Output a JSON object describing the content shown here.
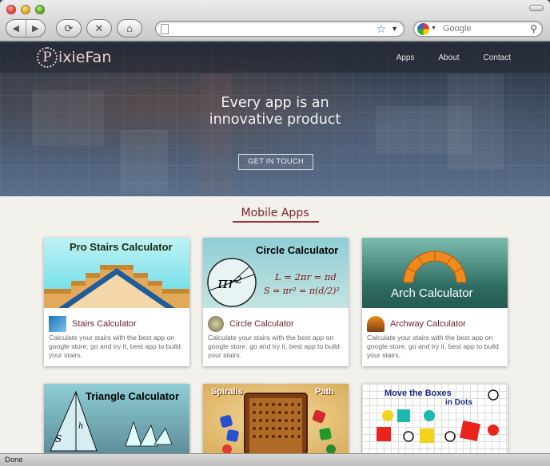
{
  "browser": {
    "url": "",
    "search_placeholder": "Google",
    "status_text": "Done"
  },
  "site": {
    "logo_initial": "P",
    "logo_rest": "ixieFan",
    "nav": [
      {
        "label": "Apps"
      },
      {
        "label": "About"
      },
      {
        "label": "Contact"
      }
    ],
    "hero": {
      "headline_line1": "Every app is an",
      "headline_line2": "innovative product",
      "cta_label": "GET IN TOUCH"
    },
    "section_title": "Mobile Apps",
    "apps": [
      {
        "image_title": "Pro Stairs Calculator",
        "name": "Stairs Calculator",
        "description": "Calculate your stairs with the best app on google store. go and try it, best app to build your stairs."
      },
      {
        "image_title": "Circle Calculator",
        "image_formula_1": "L = 2πr = πd",
        "image_formula_2": "S = πr² = π(d/2)²",
        "image_symbol": "πr²",
        "name": "Circle Calculator",
        "description": "Calculate your stairs with the best app on google store. go and try it, best app to build your stairs."
      },
      {
        "image_title": "Arch Calculator",
        "name": "Archway Calculator",
        "description": "Calculate your stairs with the best app on google store. go and try it, best app to build your stairs."
      },
      {
        "image_title": "Triangle Calculator",
        "image_label_s": "S",
        "image_label_h": "h"
      },
      {
        "image_title_left": "Spiralis",
        "image_title_right": "Path"
      },
      {
        "image_title": "Move the Boxes",
        "image_subtitle": "in Dots"
      }
    ]
  },
  "colors": {
    "accent": "#7a2230",
    "link_text": "#6a1e2a",
    "page_bg": "#f3f1ec"
  }
}
